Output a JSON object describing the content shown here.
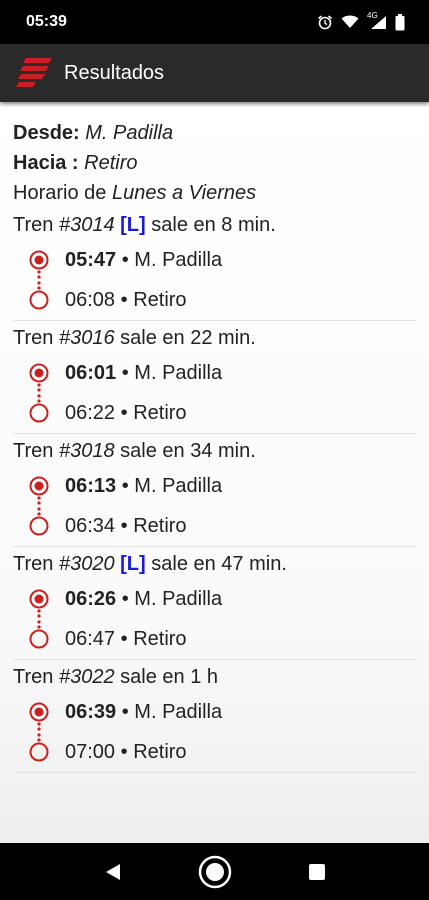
{
  "status_bar": {
    "time": "05:39",
    "network_label": "4G"
  },
  "app_bar": {
    "title": "Resultados"
  },
  "query": {
    "from_label": "Desde:",
    "from_value": "M. Padilla",
    "to_label": "Hacia :",
    "to_value": "Retiro",
    "schedule_prefix": "Horario de",
    "schedule_value": "Lunes a Viernes"
  },
  "trips": [
    {
      "prefix": "Tren",
      "number": "#3014",
      "badge": "[L]",
      "departs_text": "sale en 8 min.",
      "departure_time": "05:47",
      "departure_station": "M. Padilla",
      "arrival_time": "06:08",
      "arrival_station": "Retiro"
    },
    {
      "prefix": "Tren",
      "number": "#3016",
      "badge": "",
      "departs_text": "sale en 22 min.",
      "departure_time": "06:01",
      "departure_station": "M. Padilla",
      "arrival_time": "06:22",
      "arrival_station": "Retiro"
    },
    {
      "prefix": "Tren",
      "number": "#3018",
      "badge": "",
      "departs_text": "sale en 34 min.",
      "departure_time": "06:13",
      "departure_station": "M. Padilla",
      "arrival_time": "06:34",
      "arrival_station": "Retiro"
    },
    {
      "prefix": "Tren",
      "number": "#3020",
      "badge": "[L]",
      "departs_text": "sale en 47 min.",
      "departure_time": "06:26",
      "departure_station": "M. Padilla",
      "arrival_time": "06:47",
      "arrival_station": "Retiro"
    },
    {
      "prefix": "Tren",
      "number": "#3022",
      "badge": "",
      "departs_text": "sale en 1 h",
      "departure_time": "06:39",
      "departure_station": "M. Padilla",
      "arrival_time": "07:00",
      "arrival_station": "Retiro"
    }
  ],
  "separator": "•",
  "colors": {
    "accent_red": "#cc1f1f",
    "badge_blue": "#1a1adb",
    "app_bar": "#2a2a2a"
  },
  "icons": {
    "logo": "red-stripes-logo-icon",
    "departure_marker": "filled-circle-icon",
    "arrival_marker": "hollow-circle-icon",
    "nav_back": "triangle-back-icon",
    "nav_home": "circle-home-icon",
    "nav_recents": "square-recents-icon"
  }
}
